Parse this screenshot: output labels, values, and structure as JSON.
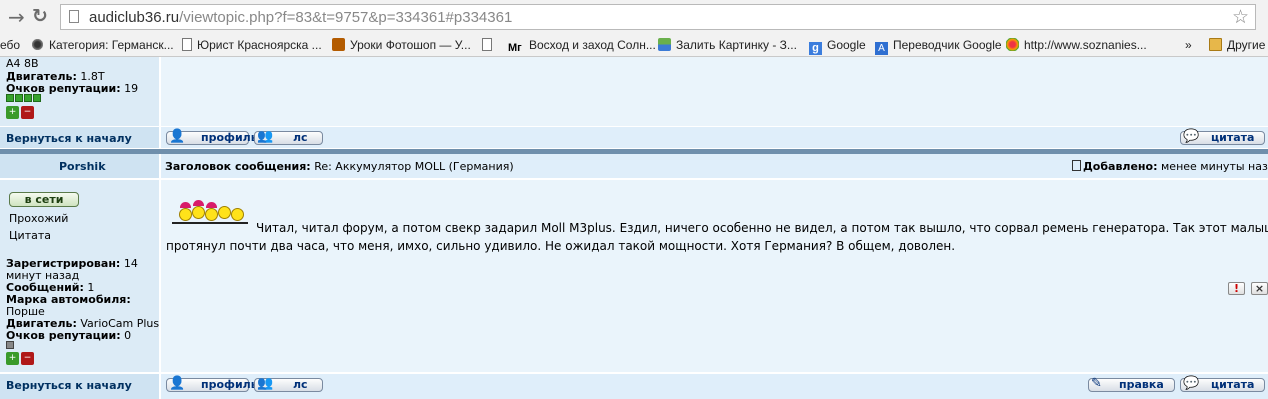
{
  "browser": {
    "url_domain": "audiclub36.ru",
    "url_path": "/viewtopic.php?f=83&t=9757&p=334361#p334361",
    "bookmarks": [
      {
        "label": "ебо"
      },
      {
        "label": "Категория: Германск..."
      },
      {
        "label": "Юрист Красноярска ..."
      },
      {
        "label": "Уроки Фотошоп — У..."
      },
      {
        "label": "Восход и заход Солн..."
      },
      {
        "label": "Залить Картинку - З..."
      },
      {
        "label": "Google"
      },
      {
        "label": "Переводчик Google"
      },
      {
        "label": "http://www.soznanies..."
      },
      {
        "label": "»"
      },
      {
        "label": "Другие"
      }
    ]
  },
  "post_prev": {
    "car_line": "A4 8B",
    "engine_label": "Двигатель:",
    "engine_value": "1.8T",
    "rep_label": "Очков репутации:",
    "rep_value": "19",
    "back_to_top": "Вернуться к началу",
    "profile_btn": "профиль",
    "pm_btn": "лс",
    "quote_btn": "цитата"
  },
  "post": {
    "author": "Porshik",
    "subject_label": "Заголовок сообщения:",
    "subject_value": "Re: Аккумулятор MOLL (Германия)",
    "added_label": "Добавлено:",
    "added_value": "менее минуты назад",
    "online_btn": "в сети",
    "rank": "Прохожий",
    "quote_link": "Цитата",
    "reg_label": "Зарегистрирован:",
    "reg_value": "14",
    "reg_value2": "минут назад",
    "msgs_label": "Сообщений:",
    "msgs_value": "1",
    "car_label": "Марка автомобиля:",
    "car_value": "Порше",
    "engine_label": "Двигатель:",
    "engine_value": "VarioCam Plus",
    "rep_label": "Очков репутации:",
    "rep_value": "0",
    "body_line1": "Читал, читал форум, а потом свекр задарил Moll M3plus. Ездил, ничего особенно не видел, а потом так вышло, что сорвал ремень генератора. Так этот малыш",
    "body_line2": "протянул почти два часа, что меня, имхо, сильно удивило. Не ожидал такой мощности. Хотя Германия? В общем, доволен.",
    "back_to_top": "Вернуться к началу",
    "profile_btn": "профиль",
    "pm_btn": "лс",
    "edit_btn": "правка",
    "quote_btn": "цитата"
  }
}
